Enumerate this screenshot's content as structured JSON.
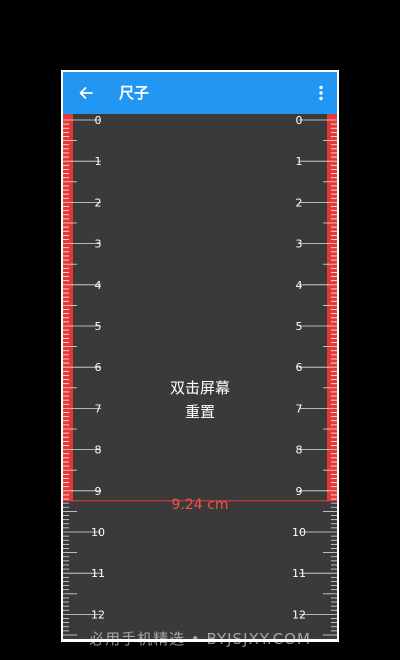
{
  "app_bar": {
    "title": "尺子",
    "back_icon": "arrow-back-icon",
    "menu_icon": "more-vert-icon",
    "color": "#2196f3"
  },
  "ruler": {
    "unit": "cm",
    "left_labels": [
      "0",
      "1",
      "2",
      "3",
      "4",
      "5",
      "6",
      "7",
      "8",
      "9",
      "10",
      "11",
      "12"
    ],
    "right_labels": [
      "0",
      "1",
      "2",
      "3",
      "4",
      "5",
      "6",
      "7",
      "8",
      "9",
      "10",
      "11",
      "12"
    ],
    "measured_value": 9.24,
    "measurement_text": "9.24 cm",
    "highlight_color": "#e53935"
  },
  "hint": {
    "line1": "双击屏幕",
    "line2": "重置"
  },
  "watermark": "必用手机精选 • BYJSJXY.COM"
}
